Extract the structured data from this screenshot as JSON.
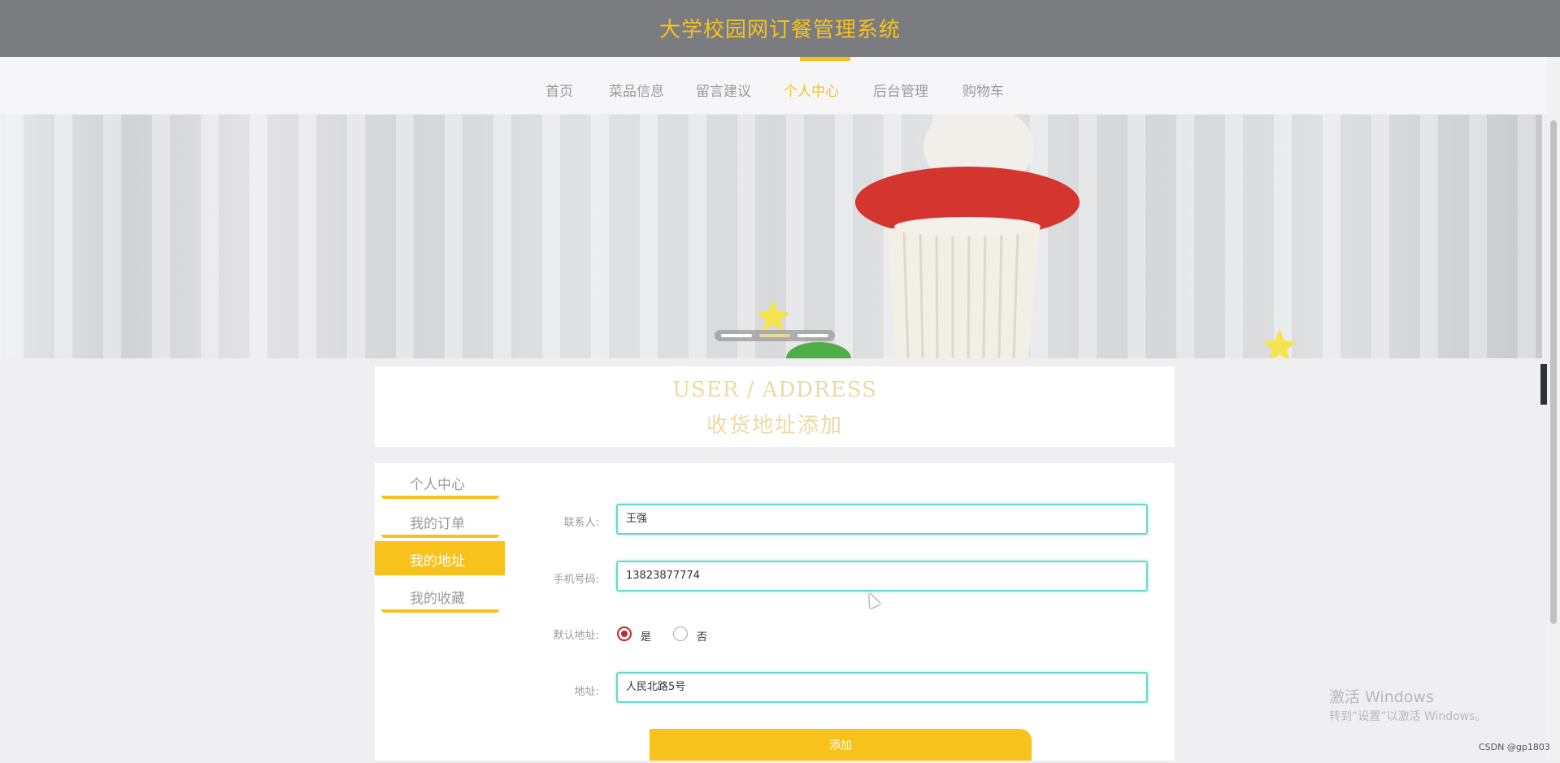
{
  "header": {
    "site_title": "大学校园网订餐管理系统"
  },
  "nav": {
    "items": [
      {
        "label": "首页"
      },
      {
        "label": "菜品信息"
      },
      {
        "label": "留言建议"
      },
      {
        "label": "个人中心",
        "active": true
      },
      {
        "label": "后台管理"
      },
      {
        "label": "购物车"
      }
    ]
  },
  "banner": {
    "slide_count": 3,
    "active_slide_index": 1
  },
  "section": {
    "title_en": "USER / ADDRESS",
    "title_cn": "收货地址添加"
  },
  "sidebar": {
    "items": [
      {
        "label": "个人中心"
      },
      {
        "label": "我的订单"
      },
      {
        "label": "我的地址",
        "active": true
      },
      {
        "label": "我的收藏"
      }
    ]
  },
  "form": {
    "contact_label": "联系人:",
    "contact_value": "王强",
    "phone_label": "手机号码:",
    "phone_value": "13823877774",
    "default_label": "默认地址:",
    "default_yes": "是",
    "default_no": "否",
    "default_selected": "是",
    "address_label": "地址:",
    "address_value": "人民北路5号",
    "submit_label": "添加"
  },
  "side_toggle": {
    "glyph": "‹"
  },
  "windows_activation": {
    "title": "激活 Windows",
    "subtitle": "转到“设置”以激活 Windows。"
  },
  "watermark": "CSDN @gp1803",
  "colors": {
    "accent": "#f7c21c",
    "header_bg": "#7b7c80",
    "input_border": "#66d9cf",
    "radio_checked": "#c1272d"
  }
}
